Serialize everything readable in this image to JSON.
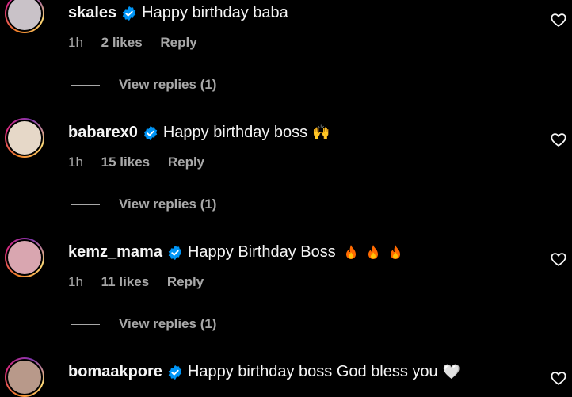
{
  "colors": {
    "background": "#000000",
    "text": "#f5f5f5",
    "secondary": "#a8a8a8",
    "verified": "#0095f6",
    "flame": "#ff6a00"
  },
  "comments": [
    {
      "username": "skales",
      "text": "Happy birthday baba",
      "emoji": "",
      "time": "1h",
      "likes": "2 likes",
      "reply": "Reply",
      "view_replies": "View replies (1)",
      "avatar_color": "#c9c2c8"
    },
    {
      "username": "babarex0",
      "text": "Happy birthday boss",
      "emoji": "🙌",
      "time": "1h",
      "likes": "15 likes",
      "reply": "Reply",
      "view_replies": "View replies (1)",
      "avatar_color": "#e6d8c8"
    },
    {
      "username": "kemz_mama",
      "text": "Happy Birthday Boss",
      "emoji": "",
      "time": "1h",
      "likes": "11 likes",
      "reply": "Reply",
      "view_replies": "View replies (1)",
      "avatar_color": "#d9a6b0"
    },
    {
      "username": "bomaakpore",
      "text": "Happy birthday boss God bless you",
      "emoji": "🤍",
      "time": "",
      "likes": "",
      "reply": "",
      "view_replies": "",
      "avatar_color": "#b8998a"
    }
  ]
}
